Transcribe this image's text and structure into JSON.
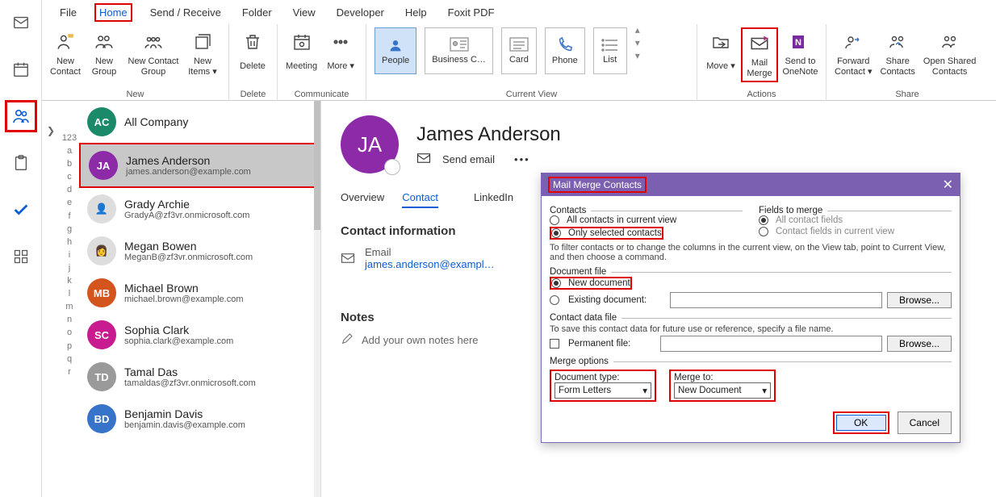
{
  "menu": {
    "file": "File",
    "home": "Home",
    "sendreceive": "Send / Receive",
    "folder": "Folder",
    "view": "View",
    "developer": "Developer",
    "help": "Help",
    "foxit": "Foxit PDF"
  },
  "ribbon": {
    "new": {
      "label": "New",
      "newContact": "New\nContact",
      "newGroup": "New\nGroup",
      "newContactGroup": "New Contact\nGroup",
      "newItems": "New\nItems ▾"
    },
    "delete": {
      "label": "Delete",
      "delete": "Delete"
    },
    "communicate": {
      "label": "Communicate",
      "meeting": "Meeting",
      "more": "More ▾"
    },
    "currentView": {
      "label": "Current View",
      "people": "People",
      "business": "Business C…",
      "card": "Card",
      "phone": "Phone",
      "list": "List"
    },
    "actions": {
      "label": "Actions",
      "move": "Move ▾",
      "mailMerge": "Mail\nMerge",
      "onenote": "Send to\nOneNote"
    },
    "share": {
      "label": "Share",
      "forward": "Forward\nContact ▾",
      "shareContacts": "Share\nContacts",
      "openShared": "Open Shared\nContacts"
    }
  },
  "az": {
    "top": "123",
    "letters": [
      "a",
      "b",
      "c",
      "d",
      "e",
      "f",
      "g",
      "h",
      "i",
      "j",
      "k",
      "l",
      "m",
      "n",
      "o",
      "p",
      "q",
      "r"
    ]
  },
  "contacts": [
    {
      "initials": "AC",
      "name": "All Company",
      "email": "",
      "color": "#1a8a6b",
      "img": false
    },
    {
      "initials": "JA",
      "name": "James Anderson",
      "email": "james.anderson@example.com",
      "color": "#8c2aa7",
      "img": false
    },
    {
      "initials": "👤",
      "name": "Grady Archie",
      "email": "GradyA@zf3vr.onmicrosoft.com",
      "color": "#ddd",
      "img": true
    },
    {
      "initials": "👩",
      "name": "Megan Bowen",
      "email": "MeganB@zf3vr.onmicrosoft.com",
      "color": "#ddd",
      "img": true
    },
    {
      "initials": "MB",
      "name": "Michael Brown",
      "email": "michael.brown@example.com",
      "color": "#d4541d",
      "img": false
    },
    {
      "initials": "SC",
      "name": "Sophia Clark",
      "email": "sophia.clark@example.com",
      "color": "#c71b8f",
      "img": false
    },
    {
      "initials": "TD",
      "name": "Tamal Das",
      "email": "tamaldas@zf3vr.onmicrosoft.com",
      "color": "#9a9a9a",
      "img": false
    },
    {
      "initials": "BD",
      "name": "Benjamin Davis",
      "email": "benjamin.davis@example.com",
      "color": "#3773c9",
      "img": false
    }
  ],
  "detail": {
    "initials": "JA",
    "name": "James Anderson",
    "sendEmail": "Send email",
    "tabs": {
      "overview": "Overview",
      "contact": "Contact",
      "linkedin": "LinkedIn"
    },
    "contactInfo": "Contact information",
    "emailLabel": "Email",
    "emailValue": "james.anderson@exampl…",
    "notesLabel": "Notes",
    "notesPlaceholder": "Add your own notes here"
  },
  "dialog": {
    "title": "Mail Merge Contacts",
    "contacts": {
      "legend": "Contacts",
      "all": "All contacts in current view",
      "only": "Only selected contacts"
    },
    "fields": {
      "legend": "Fields to merge",
      "all": "All contact fields",
      "inView": "Contact fields in current view"
    },
    "filterNote": "To filter contacts or to change the columns in the current view, on the View tab, point to Current View, and then choose a command.",
    "docFile": {
      "legend": "Document file",
      "new": "New document",
      "existing": "Existing document:",
      "browse": "Browse..."
    },
    "dataFile": {
      "legend": "Contact data file",
      "note": "To save this contact data for future use or reference, specify a file name.",
      "permanent": "Permanent file:",
      "browse": "Browse..."
    },
    "merge": {
      "legend": "Merge options",
      "docTypeLabel": "Document type:",
      "docTypeValue": "Form Letters",
      "mergeToLabel": "Merge to:",
      "mergeToValue": "New Document"
    },
    "ok": "OK",
    "cancel": "Cancel"
  }
}
